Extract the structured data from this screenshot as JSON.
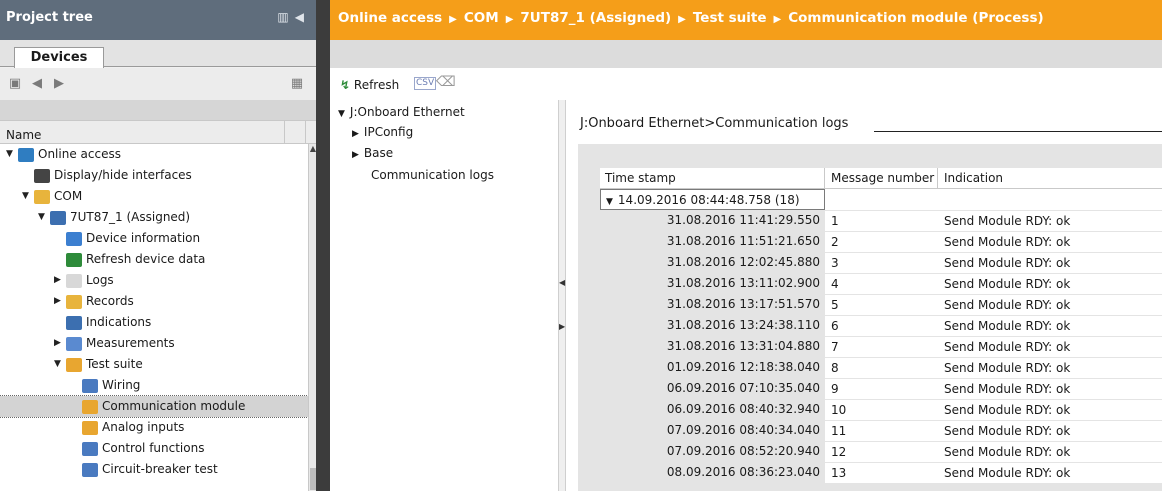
{
  "project_tree": {
    "title": "Project tree",
    "tab_devices": "Devices",
    "column_name": "Name",
    "items": [
      {
        "label": "Online access",
        "icon": "online-access-icon",
        "color": "#2f7dc1",
        "indent": 0,
        "arrow": "▼"
      },
      {
        "label": "Display/hide interfaces",
        "icon": "interface-icon",
        "color": "#444444",
        "indent": 1,
        "arrow": ""
      },
      {
        "label": "COM",
        "icon": "folder-icon",
        "color": "#e8b43c",
        "indent": 1,
        "arrow": "▼"
      },
      {
        "label": "7UT87_1 (Assigned)",
        "icon": "device-icon",
        "color": "#3c6fb0",
        "indent": 2,
        "arrow": "▼"
      },
      {
        "label": "Device information",
        "icon": "device-info-icon",
        "color": "#3c7fd0",
        "indent": 3,
        "arrow": ""
      },
      {
        "label": "Refresh device data",
        "icon": "refresh-icon",
        "color": "#2e8b3a",
        "indent": 3,
        "arrow": ""
      },
      {
        "label": "Logs",
        "icon": "logs-icon",
        "color": "#d8d8d8",
        "indent": 3,
        "arrow": "▶"
      },
      {
        "label": "Records",
        "icon": "folder-icon",
        "color": "#e8b43c",
        "indent": 3,
        "arrow": "▶"
      },
      {
        "label": "Indications",
        "icon": "indications-icon",
        "color": "#3c6fb0",
        "indent": 3,
        "arrow": ""
      },
      {
        "label": "Measurements",
        "icon": "measurements-icon",
        "color": "#5a8ad0",
        "indent": 3,
        "arrow": "▶"
      },
      {
        "label": "Test suite",
        "icon": "test-suite-icon",
        "color": "#e8a630",
        "indent": 3,
        "arrow": "▼"
      },
      {
        "label": "Wiring",
        "icon": "wiring-icon",
        "color": "#4a7ac0",
        "indent": 4,
        "arrow": ""
      },
      {
        "label": "Communication module",
        "icon": "communication-module-icon",
        "color": "#e8a630",
        "indent": 4,
        "arrow": ""
      },
      {
        "label": "Analog inputs",
        "icon": "analog-inputs-icon",
        "color": "#e8a630",
        "indent": 4,
        "arrow": ""
      },
      {
        "label": "Control functions",
        "icon": "control-functions-icon",
        "color": "#4a7ac0",
        "indent": 4,
        "arrow": ""
      },
      {
        "label": "Circuit-breaker test",
        "icon": "circuit-breaker-icon",
        "color": "#4a7ac0",
        "indent": 4,
        "arrow": ""
      }
    ]
  },
  "breadcrumb": [
    "Online access",
    "COM",
    "7UT87_1 (Assigned)",
    "Test suite",
    "Communication module (Process)"
  ],
  "toolbar": {
    "refresh_label": "Refresh",
    "csv_label": "CSV"
  },
  "nav_tree": {
    "root": "J:Onboard Ethernet",
    "children": [
      "IPConfig",
      "Base",
      "Communication logs"
    ]
  },
  "content": {
    "title": "J:Onboard Ethernet>Communication logs",
    "columns": [
      "Time stamp",
      "Message number",
      "Indication"
    ],
    "group_label": "14.09.2016 08:44:48.758 (18)",
    "rows": [
      {
        "time": "31.08.2016 11:41:29.550",
        "num": "1",
        "ind": "Send Module RDY: ok"
      },
      {
        "time": "31.08.2016 11:51:21.650",
        "num": "2",
        "ind": "Send Module RDY: ok"
      },
      {
        "time": "31.08.2016 12:02:45.880",
        "num": "3",
        "ind": "Send Module RDY: ok"
      },
      {
        "time": "31.08.2016 13:11:02.900",
        "num": "4",
        "ind": "Send Module RDY: ok"
      },
      {
        "time": "31.08.2016 13:17:51.570",
        "num": "5",
        "ind": "Send Module RDY: ok"
      },
      {
        "time": "31.08.2016 13:24:38.110",
        "num": "6",
        "ind": "Send Module RDY: ok"
      },
      {
        "time": "31.08.2016 13:31:04.880",
        "num": "7",
        "ind": "Send Module RDY: ok"
      },
      {
        "time": "01.09.2016 12:18:38.040",
        "num": "8",
        "ind": "Send Module RDY: ok"
      },
      {
        "time": "06.09.2016 07:10:35.040",
        "num": "9",
        "ind": "Send Module RDY: ok"
      },
      {
        "time": "06.09.2016 08:40:32.940",
        "num": "10",
        "ind": "Send Module RDY: ok"
      },
      {
        "time": "07.09.2016 08:40:34.040",
        "num": "11",
        "ind": "Send Module RDY: ok"
      },
      {
        "time": "07.09.2016 08:52:20.940",
        "num": "12",
        "ind": "Send Module RDY: ok"
      },
      {
        "time": "08.09.2016 08:36:23.040",
        "num": "13",
        "ind": "Send Module RDY: ok"
      }
    ]
  },
  "colors": {
    "breadcrumb_bg": "#f59e19",
    "tree_title_bg": "#5f6d7c",
    "divider": "#3c3c3c"
  }
}
